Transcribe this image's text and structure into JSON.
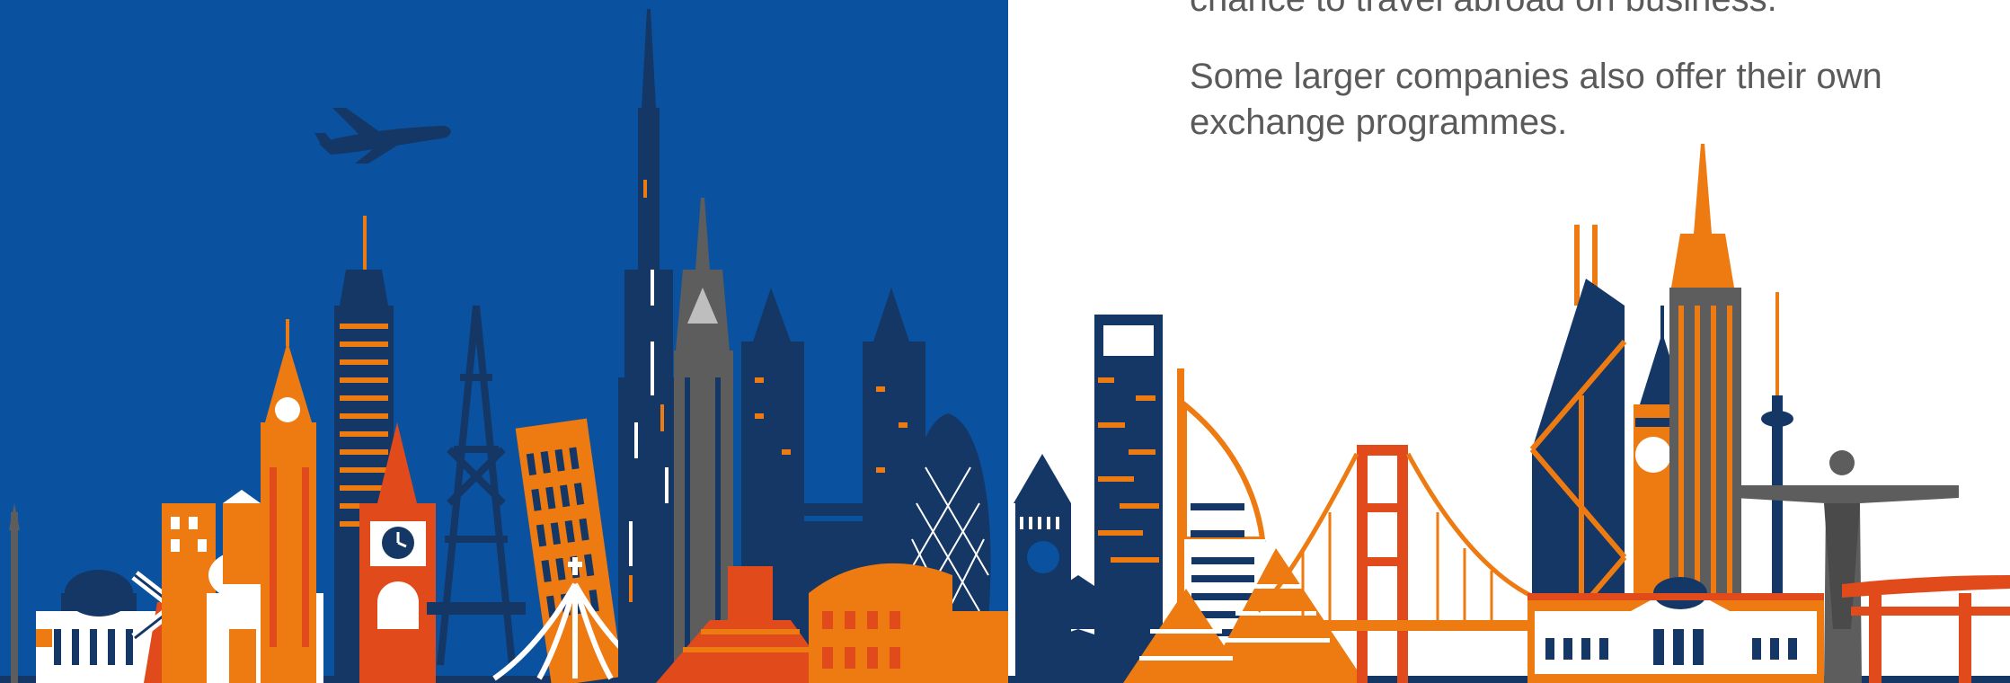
{
  "text": {
    "line_partial": "chance to travel abroad on business.",
    "paragraph": "Some larger companies also offer their own exchange programmes."
  },
  "colors": {
    "blue_bg": "#0a52a0",
    "navy": "#143766",
    "orange": "#ee7a12",
    "red_orange": "#e14a1b",
    "gray": "#5d5d5d",
    "white": "#ffffff",
    "text_gray": "#5a5a5a"
  },
  "icons": {
    "airplane": "airplane-icon",
    "clock": "clock-icon"
  }
}
